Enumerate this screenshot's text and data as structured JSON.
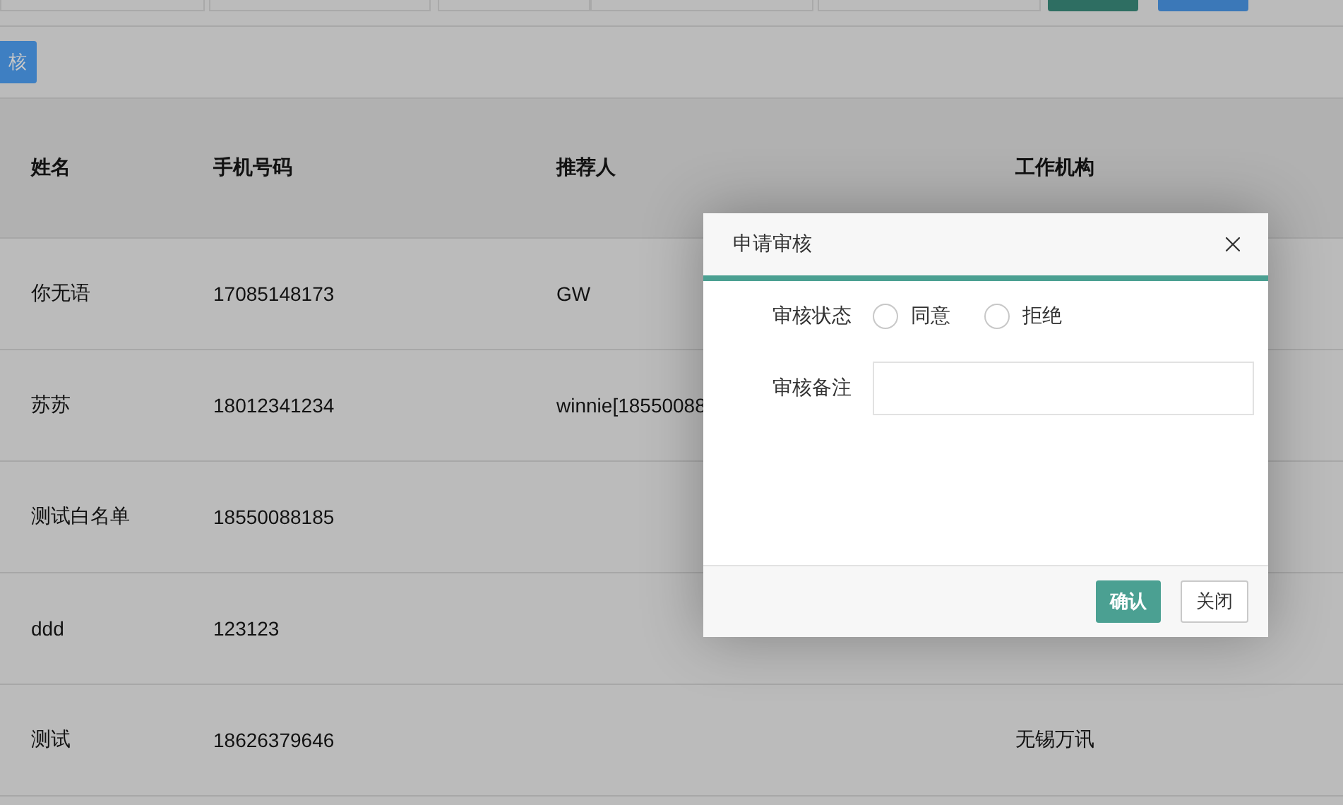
{
  "toolbar": {
    "audit_button": "核"
  },
  "table": {
    "columns": [
      "姓名",
      "手机号码",
      "推荐人",
      "工作机构"
    ],
    "rows": [
      [
        "你无语",
        "17085148173",
        "GW",
        ""
      ],
      [
        "苏苏",
        "18012341234",
        "winnie[18550088",
        ""
      ],
      [
        "测试白名单",
        "18550088185",
        "",
        ""
      ],
      [
        "ddd",
        "123123",
        "",
        ""
      ],
      [
        "测试",
        "18626379646",
        "",
        "无锡万讯"
      ]
    ]
  },
  "dialog": {
    "title": "申请审核",
    "fields": [
      {
        "kind": "radio",
        "label": "审核状态",
        "options": [
          {
            "label": "同意",
            "selected": false
          },
          {
            "label": "拒绝",
            "selected": false
          }
        ]
      },
      {
        "kind": "text",
        "label": "审核备注"
      }
    ],
    "buttons": [
      {
        "label": "确认",
        "kind": "primary"
      },
      {
        "label": "关闭",
        "kind": "default"
      }
    ]
  }
}
